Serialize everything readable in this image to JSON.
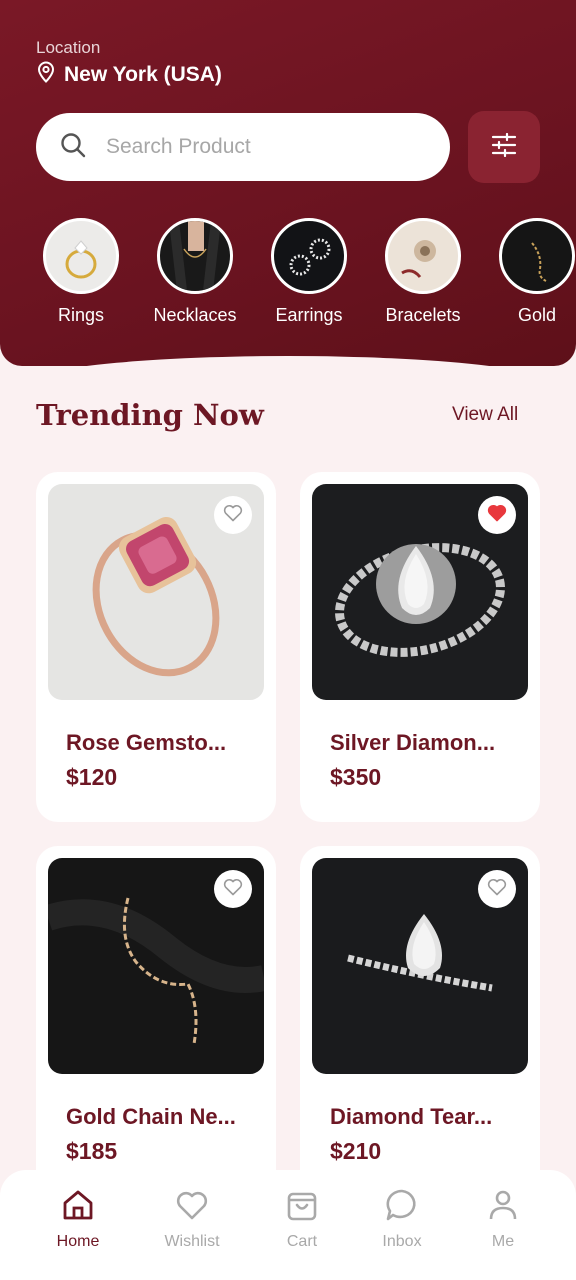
{
  "location": {
    "label": "Location",
    "value": "New York (USA)"
  },
  "search": {
    "placeholder": "Search Product"
  },
  "categories": [
    {
      "label": "Rings",
      "icon": "ring-photo"
    },
    {
      "label": "Necklaces",
      "icon": "necklace-photo"
    },
    {
      "label": "Earrings",
      "icon": "earrings-photo"
    },
    {
      "label": "Bracelets",
      "icon": "bracelets-photo"
    },
    {
      "label": "Gold",
      "icon": "gold-photo"
    }
  ],
  "trending": {
    "title": "Trending Now",
    "view_all": "View All",
    "products": [
      {
        "name": "Rose Gemsto...",
        "price": "$120",
        "favorite": false
      },
      {
        "name": "Silver Diamon...",
        "price": "$350",
        "favorite": true
      },
      {
        "name": "Gold Chain Ne...",
        "price": "$185",
        "favorite": false
      },
      {
        "name": "Diamond Tear...",
        "price": "$210",
        "favorite": false
      }
    ]
  },
  "nav": [
    {
      "label": "Home",
      "icon": "home-icon",
      "active": true
    },
    {
      "label": "Wishlist",
      "icon": "heart-icon",
      "active": false
    },
    {
      "label": "Cart",
      "icon": "bag-icon",
      "active": false
    },
    {
      "label": "Inbox",
      "icon": "chat-icon",
      "active": false
    },
    {
      "label": "Me",
      "icon": "user-icon",
      "active": false
    }
  ],
  "colors": {
    "primary": "#6d1724",
    "header_bg": "#6a1320",
    "page_bg": "#fbf1f2",
    "favorite": "#e8383d"
  }
}
